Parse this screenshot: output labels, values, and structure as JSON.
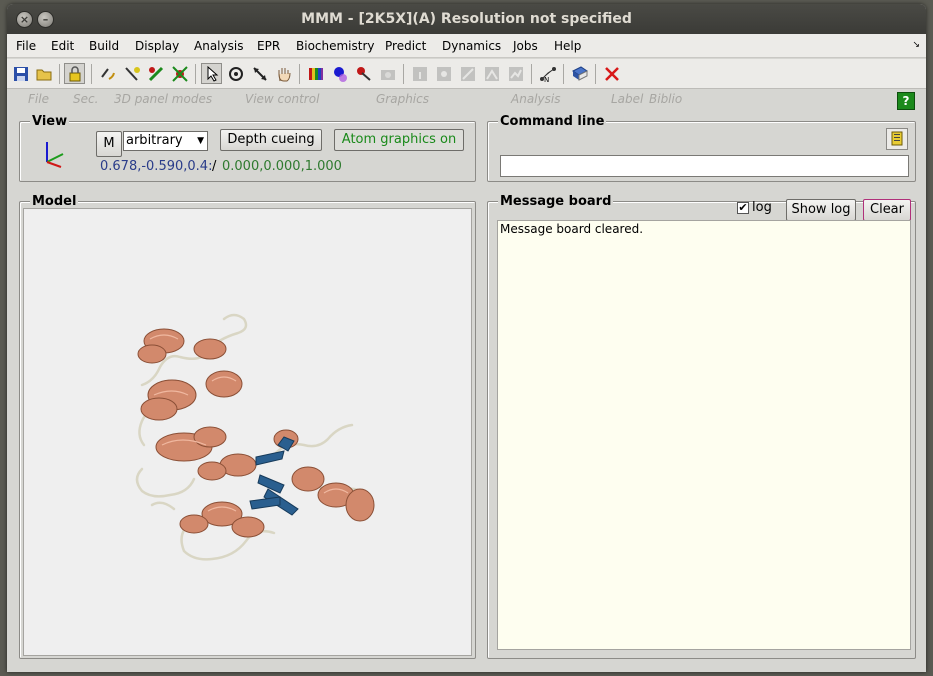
{
  "window": {
    "title": "MMM - [2K5X](A) Resolution not specified"
  },
  "menu": [
    "File",
    "Edit",
    "Build",
    "Display",
    "Analysis",
    "EPR",
    "Biochemistry",
    "Predict",
    "Dynamics",
    "Jobs",
    "Help"
  ],
  "panel_modes": [
    "File",
    "Sec.",
    "3D panel modes",
    "View control",
    "Graphics",
    "Analysis",
    "Label",
    "Biblio"
  ],
  "view": {
    "label": "View",
    "m_button": "M",
    "projection": "arbitrary",
    "depth_cueing": "Depth cueing",
    "atom_graphics": "Atom graphics on",
    "view_vector": "0.678,-0.590,0.4:",
    "separator": "/",
    "up_vector": "0.000,0.000,1.000",
    "colors": {
      "view_vector": "#2a3c8a",
      "up_vector": "#2f7a2f",
      "atom_graphics": "#1a8a1a"
    }
  },
  "command_line": {
    "label": "Command line",
    "value": ""
  },
  "model": {
    "label": "Model",
    "colors": {
      "helix": "#d2896c",
      "sheet": "#2a5f8f",
      "coil": "#d9d6c4"
    }
  },
  "message_board": {
    "label": "Message board",
    "log_checkbox_label": "log",
    "log_checked": true,
    "show_log_button": "Show log",
    "clear_button": "Clear",
    "messages": [
      "Message board cleared."
    ]
  },
  "toolbar_icons": [
    "save-icon",
    "open-folder-icon",
    "lock-icon",
    "rotate-bond-icon",
    "add-atom-icon",
    "mutate-icon",
    "select-residue-icon",
    "pointer-icon",
    "rotate-icon",
    "zoom-icon",
    "pan-hand-icon",
    "color-icon",
    "surface-icon",
    "label-icon",
    "camera-icon",
    "info-icon",
    "tag-icon",
    "measure-distance-icon",
    "measure-angle-icon",
    "plot-icon",
    "network-icon",
    "book-icon",
    "close-x-icon"
  ]
}
